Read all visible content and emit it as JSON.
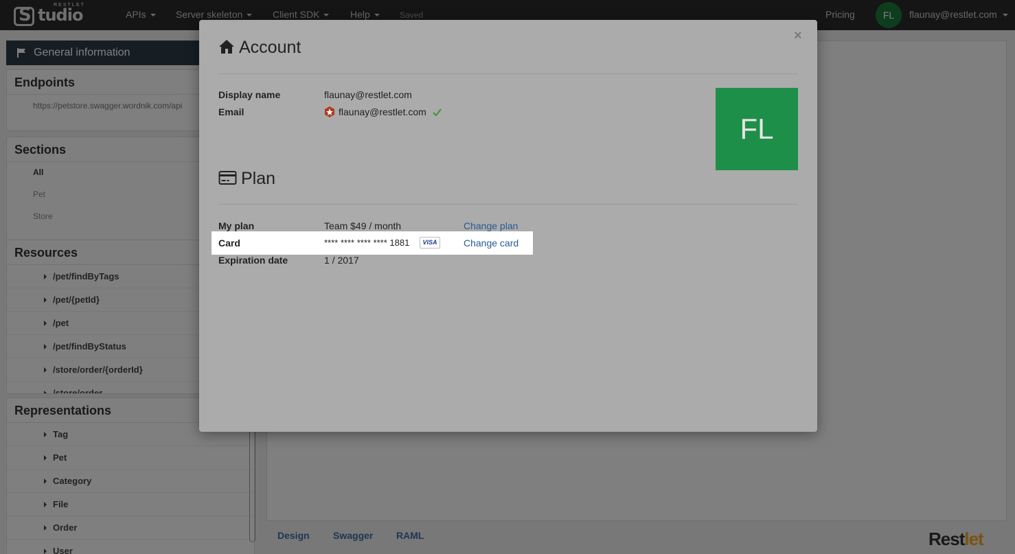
{
  "navbar": {
    "brand_small": "RESTLET",
    "brand_word": "tudio",
    "menus": [
      {
        "label": "APIs"
      },
      {
        "label": "Server skeleton"
      },
      {
        "label": "Client SDK"
      },
      {
        "label": "Help"
      }
    ],
    "saved": "Saved",
    "pricing": "Pricing",
    "avatar_initials": "FL",
    "user_email": "flaunay@restlet.com"
  },
  "sidebar": {
    "general_information": "General information",
    "endpoints": {
      "title": "Endpoints",
      "url": "https://petstore.swagger.wordnik.com/api"
    },
    "sections": {
      "title": "Sections",
      "items": [
        "All",
        "Pet",
        "Store"
      ],
      "active": "All"
    },
    "resources": {
      "title": "Resources",
      "items": [
        "/pet/findByTags",
        "/pet/{petId}",
        "/pet",
        "/pet/findByStatus",
        "/store/order/{orderId}",
        "/store/order"
      ]
    },
    "representations": {
      "title": "Representations",
      "items": [
        "Tag",
        "Pet",
        "Category",
        "File",
        "Order",
        "User"
      ]
    }
  },
  "bottom_tabs": [
    "Design",
    "Swagger",
    "RAML"
  ],
  "footer_logo": {
    "part1": "Rest",
    "part2": "let"
  },
  "modal": {
    "close": "×",
    "account_title": "Account",
    "display_name_label": "Display name",
    "display_name_value": "flaunay@restlet.com",
    "email_label": "Email",
    "email_value": "flaunay@restlet.com",
    "avatar_initials": "FL",
    "plan_title": "Plan",
    "my_plan_label": "My plan",
    "my_plan_value": "Team $49 / month",
    "change_plan": "Change plan",
    "card_label": "Card",
    "card_value": "**** **** **** **** 1881",
    "card_brand": "VISA",
    "change_card": "Change card",
    "expiration_label": "Expiration date",
    "expiration_value": "1 / 2017"
  },
  "colors": {
    "navbar_bg": "#2a2a2a",
    "avatar_green": "#1d8f48",
    "link_blue": "#2a5a90",
    "general_info_bg": "#2d3d48"
  }
}
